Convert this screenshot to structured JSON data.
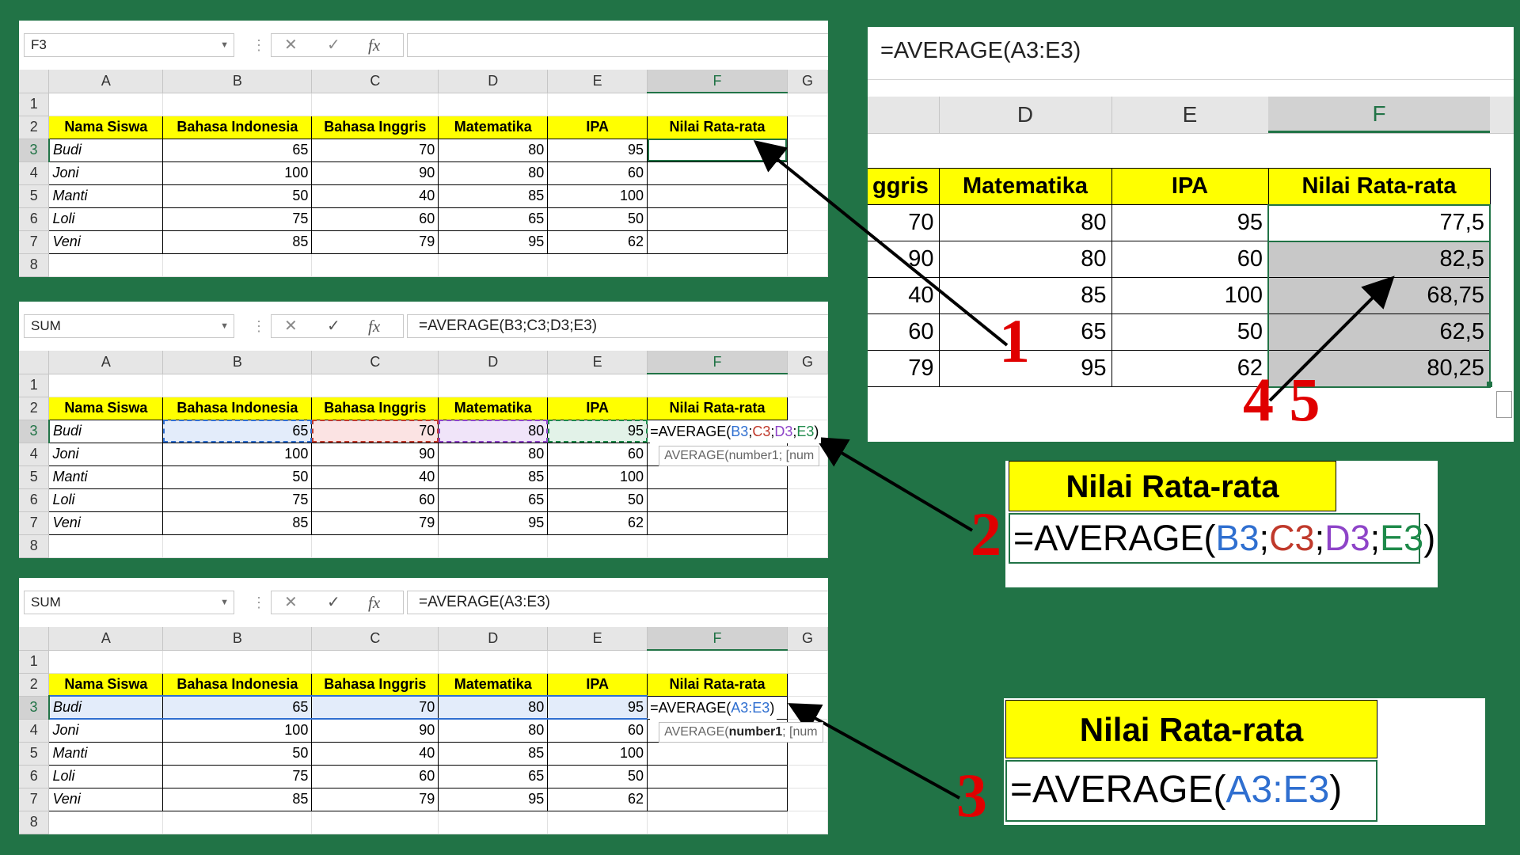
{
  "columns": [
    "A",
    "B",
    "C",
    "D",
    "E",
    "F",
    "G"
  ],
  "headers": [
    "Nama Siswa",
    "Bahasa Indonesia",
    "Bahasa Inggris",
    "Matematika",
    "IPA",
    "Nilai Rata-rata"
  ],
  "rows": [
    {
      "name": "Budi",
      "b": "65",
      "c": "70",
      "d": "80",
      "e": "95"
    },
    {
      "name": "Joni",
      "b": "100",
      "c": "90",
      "d": "80",
      "e": "60"
    },
    {
      "name": "Manti",
      "b": "50",
      "c": "40",
      "d": "85",
      "e": "100"
    },
    {
      "name": "Loli",
      "b": "75",
      "c": "60",
      "d": "65",
      "e": "50"
    },
    {
      "name": "Veni",
      "b": "85",
      "c": "79",
      "d": "95",
      "e": "62"
    }
  ],
  "row_numbers": [
    "1",
    "2",
    "3",
    "4",
    "5",
    "6",
    "7",
    "8"
  ],
  "panel1": {
    "namebox": "F3",
    "formula": ""
  },
  "panel2": {
    "namebox": "SUM",
    "formula": "=AVERAGE(B3;C3;D3;E3)",
    "cell_parts": [
      "=AVERAGE(",
      "B3",
      ";",
      "C3",
      ";",
      "D3",
      ";",
      "E3",
      ")"
    ],
    "tooltip": "AVERAGE(number1; [num"
  },
  "panel3": {
    "namebox": "SUM",
    "formula": "=AVERAGE(A3:E3)",
    "cell_parts": [
      "=AVERAGE(",
      "A3:E3",
      ")"
    ],
    "tooltip_fn": "AVERAGE(",
    "tooltip_arg": "number1",
    "tooltip_rest": "; [num"
  },
  "zoom": {
    "formula": "=AVERAGE(A3:E3)",
    "col_letters": [
      "D",
      "E",
      "F"
    ],
    "partial_header": "ggris",
    "header_d": "Matematika",
    "header_e": "IPA",
    "header_f": "Nilai Rata-rata",
    "rows": [
      {
        "c": "70",
        "d": "80",
        "e": "95",
        "f": "77,5"
      },
      {
        "c": "90",
        "d": "80",
        "e": "60",
        "f": "82,5"
      },
      {
        "c": "40",
        "d": "85",
        "e": "100",
        "f": "68,75"
      },
      {
        "c": "60",
        "d": "65",
        "e": "50",
        "f": "62,5"
      },
      {
        "c": "79",
        "d": "95",
        "e": "62",
        "f": "80,25"
      }
    ]
  },
  "callout2": {
    "header": "Nilai Rata-rata",
    "parts": [
      "=AVERAGE(",
      "B3",
      ";",
      "C3",
      ";",
      "D3",
      ";",
      "E3",
      ")"
    ]
  },
  "callout3": {
    "header": "Nilai Rata-rata",
    "parts": [
      "=AVERAGE(",
      "A3:E3",
      ")"
    ]
  },
  "annotations": {
    "n1": "1",
    "n2": "2",
    "n3": "3",
    "n45": "4 5"
  },
  "colors": {
    "background": "#217346",
    "header_fill": "#ffff00",
    "annotation": "#e00000",
    "ref_b": "#2f6fd0",
    "ref_c": "#c0392b",
    "ref_d": "#8e44c8",
    "ref_e": "#1e8a4a"
  }
}
